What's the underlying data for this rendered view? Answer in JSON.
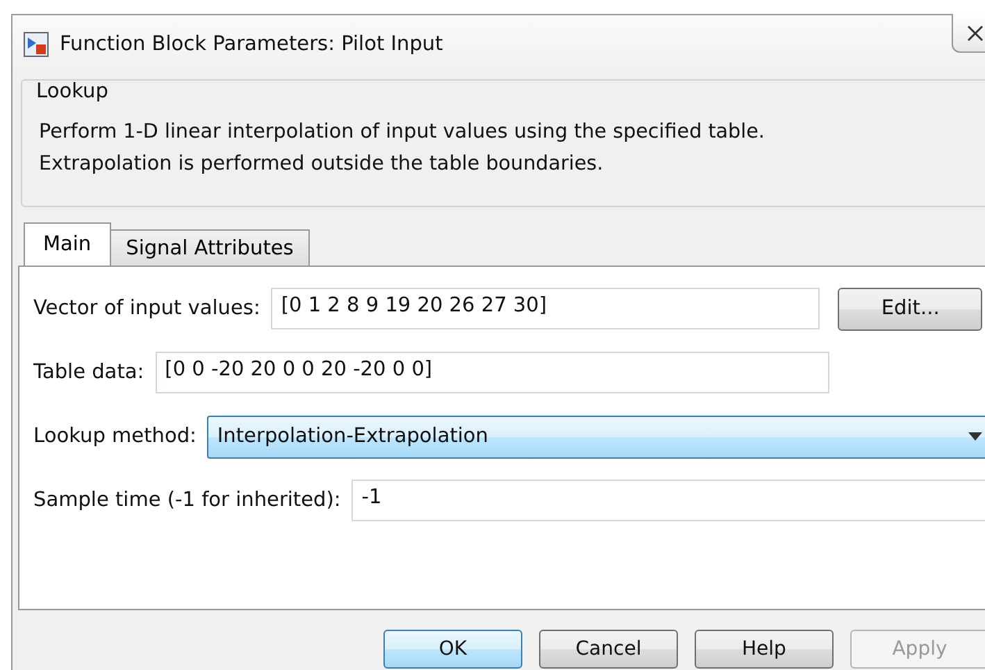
{
  "window": {
    "title": "Function Block Parameters: Pilot Input"
  },
  "group": {
    "title": "Lookup",
    "description": "Perform 1-D linear interpolation of input values using the specified table.\nExtrapolation is performed outside the table boundaries."
  },
  "tabs": [
    {
      "label": "Main",
      "selected": true
    },
    {
      "label": "Signal Attributes",
      "selected": false
    }
  ],
  "parameters": [
    {
      "kind": "text",
      "label": "Vector of input values:",
      "value": "[0 1 2 8 9 19 20 26 27 30]",
      "button": "Edit..."
    },
    {
      "kind": "text",
      "label": "Table data:",
      "value": "[0 0 -20 20 0 0 20 -20 0 0]"
    },
    {
      "kind": "select",
      "label": "Lookup method:",
      "value": "Interpolation-Extrapolation"
    },
    {
      "kind": "text",
      "label": "Sample time (-1 for inherited):",
      "value": "-1"
    }
  ],
  "buttons": [
    {
      "label": "OK",
      "default": true,
      "disabled": false
    },
    {
      "label": "Cancel",
      "default": false,
      "disabled": false
    },
    {
      "label": "Help",
      "default": false,
      "disabled": false
    },
    {
      "label": "Apply",
      "default": false,
      "disabled": true
    }
  ]
}
